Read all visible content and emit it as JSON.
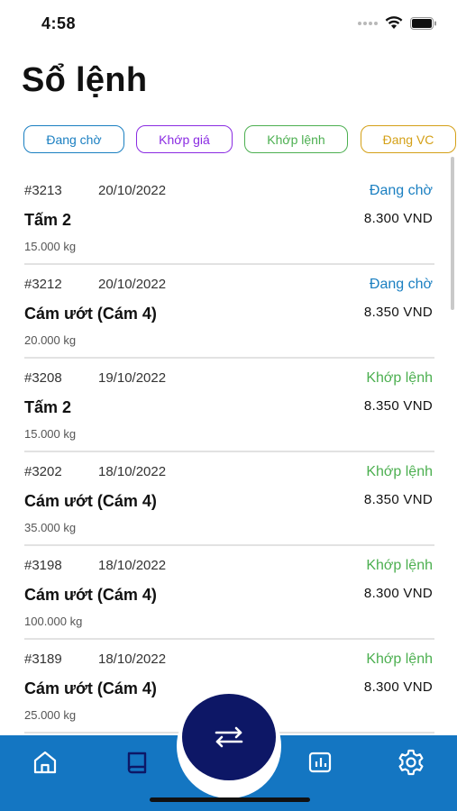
{
  "status_bar": {
    "time": "4:58"
  },
  "page": {
    "title": "Sổ lệnh"
  },
  "filters": [
    {
      "label": "Đang chờ",
      "color": "#1a7fc1"
    },
    {
      "label": "Khớp giá",
      "color": "#8a2be2"
    },
    {
      "label": "Khớp lệnh",
      "color": "#4caf50"
    },
    {
      "label": "Đang VC",
      "color": "#d4a017"
    }
  ],
  "orders": [
    {
      "id": "#3213",
      "date": "20/10/2022",
      "status": "Đang chờ",
      "status_color": "#1a7fc1",
      "name": "Tấm 2",
      "price": "8.300 VND",
      "weight": "15.000 kg"
    },
    {
      "id": "#3212",
      "date": "20/10/2022",
      "status": "Đang chờ",
      "status_color": "#1a7fc1",
      "name": "Cám ướt (Cám 4)",
      "price": "8.350 VND",
      "weight": "20.000 kg"
    },
    {
      "id": "#3208",
      "date": "19/10/2022",
      "status": "Khớp lệnh",
      "status_color": "#4caf50",
      "name": "Tấm 2",
      "price": "8.350 VND",
      "weight": "15.000 kg"
    },
    {
      "id": "#3202",
      "date": "18/10/2022",
      "status": "Khớp lệnh",
      "status_color": "#4caf50",
      "name": "Cám ướt (Cám 4)",
      "price": "8.350 VND",
      "weight": "35.000 kg"
    },
    {
      "id": "#3198",
      "date": "18/10/2022",
      "status": "Khớp lệnh",
      "status_color": "#4caf50",
      "name": "Cám ướt (Cám 4)",
      "price": "8.300 VND",
      "weight": "100.000 kg"
    },
    {
      "id": "#3189",
      "date": "18/10/2022",
      "status": "Khớp lệnh",
      "status_color": "#4caf50",
      "name": "Cám ướt (Cám 4)",
      "price": "8.300 VND",
      "weight": "25.000 kg"
    }
  ],
  "bottom_nav": {
    "background": "#1476c2",
    "fab_color": "#0d1766",
    "items": [
      {
        "icon": "home-icon"
      },
      {
        "icon": "book-icon",
        "active": true
      },
      {
        "icon": "swap-icon"
      },
      {
        "icon": "chart-icon"
      },
      {
        "icon": "gear-icon"
      }
    ]
  }
}
